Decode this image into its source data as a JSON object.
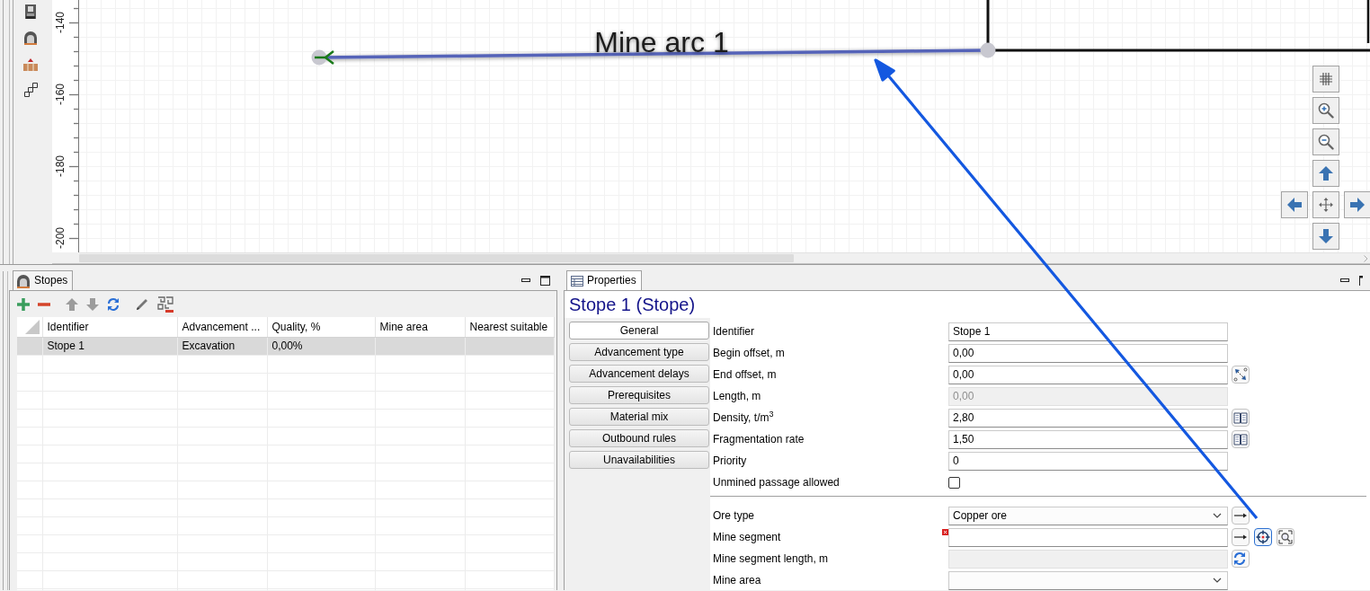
{
  "canvas": {
    "arc_label": "Mine arc 1",
    "y_axis": {
      "labels": [
        "-140",
        "-160",
        "-180",
        "-200"
      ]
    }
  },
  "stopes_panel": {
    "tab": "Stopes",
    "columns": [
      "Identifier",
      "Advancement ...",
      "Quality, %",
      "Mine area",
      "Nearest suitable"
    ],
    "rows": [
      {
        "cells": [
          "Stope 1",
          "Excavation",
          "0,00%"
        ],
        "selected": true
      }
    ]
  },
  "properties_panel": {
    "tab": "Properties",
    "title": "Stope 1 (Stope)",
    "sections": [
      {
        "label": "General",
        "selected": true
      },
      {
        "label": "Advancement type",
        "selected": false
      },
      {
        "label": "Advancement delays",
        "selected": false
      },
      {
        "label": "Prerequisites",
        "selected": false
      },
      {
        "label": "Material mix",
        "selected": false
      },
      {
        "label": "Outbound rules",
        "selected": false
      },
      {
        "label": "Unavailabilities",
        "selected": false
      }
    ],
    "fields": [
      {
        "kind": "text",
        "label": "Identifier",
        "value": "Stope 1",
        "disabled": false,
        "error": false
      },
      {
        "kind": "text",
        "label": "Begin offset, m",
        "value": "0,00",
        "disabled": false,
        "error": false
      },
      {
        "kind": "text",
        "label": "End offset, m",
        "value": "0,00",
        "disabled": false,
        "error": false,
        "buttons": [
          {
            "kind": "measure",
            "active": false
          }
        ]
      },
      {
        "kind": "text",
        "label": "Length, m",
        "value": "0,00",
        "disabled": true,
        "error": false
      },
      {
        "kind": "text",
        "label": "Density, t/m$^{3}$",
        "value": "2,80",
        "disabled": false,
        "error": false,
        "buttons": [
          {
            "kind": "book",
            "active": false
          }
        ]
      },
      {
        "kind": "text",
        "label": "Fragmentation rate",
        "value": "1,50",
        "disabled": false,
        "error": false,
        "buttons": [
          {
            "kind": "book",
            "active": false
          }
        ]
      },
      {
        "kind": "text",
        "label": "Priority",
        "value": "0",
        "disabled": false,
        "error": false
      },
      {
        "kind": "checkbox",
        "label": "Unmined passage allowed",
        "checked": false
      },
      {
        "kind": "separator"
      },
      {
        "kind": "combo",
        "label": "Ore type",
        "value": "Copper ore",
        "disabled": false,
        "error": false,
        "buttons": [
          {
            "kind": "link",
            "active": false
          }
        ]
      },
      {
        "kind": "text",
        "label": "Mine segment",
        "disabled": false,
        "error": true,
        "buttons": [
          {
            "kind": "link",
            "active": false
          },
          {
            "kind": "locate",
            "active": true
          },
          {
            "kind": "zoom_fit",
            "active": false
          }
        ]
      },
      {
        "kind": "text",
        "label": "Mine segment length, m",
        "disabled": true,
        "error": false,
        "buttons": [
          {
            "kind": "refresh",
            "active": false
          }
        ]
      },
      {
        "kind": "combo",
        "label": "Mine area",
        "disabled": false,
        "error": false
      }
    ]
  }
}
